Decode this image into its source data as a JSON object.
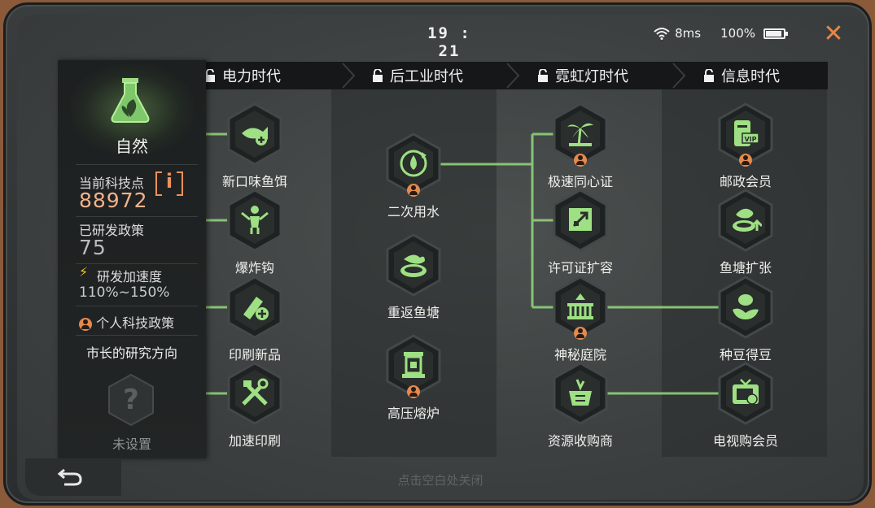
{
  "status_bar": {
    "time": "19 : 21",
    "ping": "8ms",
    "battery": "100%"
  },
  "eras": [
    {
      "label": "电力时代",
      "locked": true
    },
    {
      "label": "后工业时代",
      "locked": true
    },
    {
      "label": "霓虹灯时代",
      "locked": true
    },
    {
      "label": "信息时代",
      "locked": true
    }
  ],
  "side_panel": {
    "category": "自然",
    "tech_points_label": "当前科技点",
    "tech_points_info": "i",
    "tech_points": "88972",
    "researched_label": "已研发政策",
    "researched": "75",
    "speed_label": "研发加速度",
    "speed": "110%~150%",
    "personal_label": "个人科技政策",
    "direction_label": "市长的研究方向",
    "unset_symbol": "?",
    "unset_label": "未设置"
  },
  "techs": {
    "electric": [
      "新口味鱼饵",
      "爆炸钩",
      "印刷新品",
      "加速印刷"
    ],
    "post_industrial": [
      "二次用水",
      "重返鱼塘",
      "高压熔炉"
    ],
    "neon": [
      "极速同心证",
      "许可证扩容",
      "神秘庭院",
      "资源收购商"
    ],
    "info": [
      "邮政会员",
      "鱼塘扩张",
      "种豆得豆",
      "电视购会员"
    ]
  },
  "icons": {
    "node_icons": [
      "bait-fish-icon",
      "explosive-hook-icon",
      "print-new-icon",
      "speed-print-icon",
      "water-recycle-icon",
      "fish-pond-icon",
      "furnace-icon",
      "palm-certificate-icon",
      "license-expand-icon",
      "garden-icon",
      "resource-buyer-icon",
      "vip-mail-icon",
      "pond-expand-icon",
      "bean-icon",
      "tv-shopping-icon"
    ]
  },
  "colors": {
    "accent_green": "#8fd07a",
    "accent_orange": "#e38a4e",
    "close_orange": "#e4864a",
    "points_orange": "#f2b28a"
  },
  "footer": {
    "hint": "点击空白处关闭"
  }
}
